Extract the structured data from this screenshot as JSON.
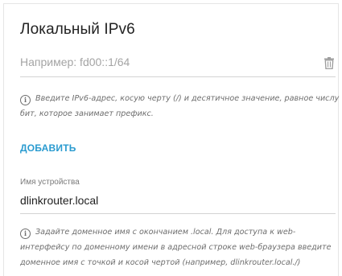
{
  "section": {
    "title": "Локальный IPv6"
  },
  "ipv6_field": {
    "value": "",
    "placeholder": "Например: fd00::1/64",
    "delete_icon": "trash-icon"
  },
  "ipv6_hint": {
    "icon": "info-icon",
    "icon_glyph": "i",
    "text": "Введите IPv6-адрес, косую черту (/) и десятичное значение, равное числу бит, которое занимает префикс."
  },
  "add_button": {
    "label": "ДОБАВИТЬ"
  },
  "device_field": {
    "label": "Имя устройства",
    "value": "dlinkrouter.local"
  },
  "device_hint": {
    "icon": "info-icon",
    "icon_glyph": "i",
    "text": "Задайте доменное имя с окончанием .local. Для доступа к web-интерфейсу по доменному имени в адресной строке web-браузера введите доменное имя с точкой и косой чертой (например, dlinkrouter.local./)"
  },
  "colors": {
    "accent": "#2a9bd0",
    "text": "#212121",
    "hint": "#6e6e6e",
    "divider": "#d3d3d3"
  }
}
